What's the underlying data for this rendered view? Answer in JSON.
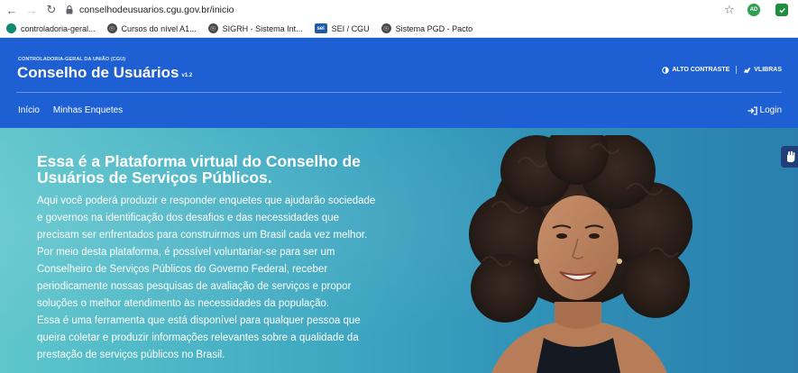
{
  "browser": {
    "url": "conselhodeusuarios.cgu.gov.br/inicio",
    "profile_initials": "AD",
    "bookmarks": [
      {
        "label": "controladoria-geral...",
        "icon": "cgu-logo-icon"
      },
      {
        "label": "Cursos do nível A1...",
        "icon": "globe-icon"
      },
      {
        "label": "SIGRH - Sistema Int...",
        "icon": "globe-icon"
      },
      {
        "label": "SEI / CGU",
        "icon": "sei-logo-icon"
      },
      {
        "label": "Sistema PGD - Pacto",
        "icon": "globe-icon"
      }
    ],
    "sei_icon_text": "sei"
  },
  "header": {
    "org": "CONTROLADORIA-GERAL DA UNIÃO (CGU)",
    "title": "Conselho de Usuários",
    "version": "v1.2",
    "high_contrast": "ALTO CONTRASTE",
    "vlibras": "VLIBRAS",
    "nav": [
      "Início",
      "Minhas Enquetes"
    ],
    "login": "Login"
  },
  "hero": {
    "heading": "Essa é a Plataforma virtual do Conselho de Usuários de Serviços Públicos.",
    "paragraph1": "Aqui você poderá produzir e responder enquetes que ajudarão sociedade e governos na identificação dos desafios e das necessidades que precisam ser enfrentados para construirmos um Brasil cada vez melhor. Por meio desta plataforma, é possível voluntariar-se para ser um Conselheiro de Serviços Públicos do Governo Federal, receber periodicamente nossas pesquisas de avaliação de serviços e propor soluções o melhor atendimento às necessidades da população.",
    "paragraph2": "Essa é uma ferramenta que está disponível para qualquer pessoa que queira coletar e produzir informações relevantes sobre a qualidade da prestação de serviços públicos no Brasil."
  },
  "colors": {
    "header_blue": "#1e5fd4",
    "hero_teal": "#3fa9c2"
  }
}
